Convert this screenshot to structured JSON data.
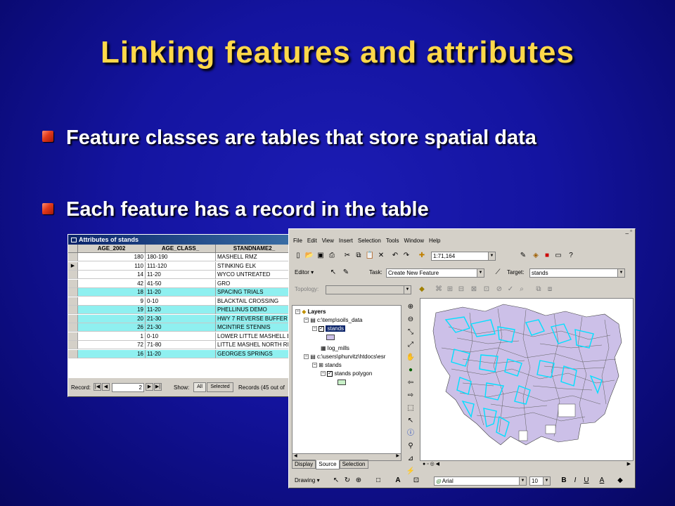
{
  "slide": {
    "title": "Linking features and attributes",
    "bullets": [
      "Feature classes are tables that store spatial data",
      "Each feature has a record in the table"
    ]
  },
  "attr_window": {
    "title": "Attributes of stands",
    "columns": [
      "AGE_2002",
      "AGE_CLASS_",
      "STANDNAME2_"
    ],
    "rows": [
      {
        "age": "180",
        "cls": "180-190",
        "name": "MASHELL RMZ",
        "hl": false
      },
      {
        "age": "110",
        "cls": "111-120",
        "name": "STINKING ELK",
        "hl": false
      },
      {
        "age": "14",
        "cls": "11-20",
        "name": "WYCO UNTREATED",
        "hl": false
      },
      {
        "age": "42",
        "cls": "41-50",
        "name": "GRO",
        "hl": false
      },
      {
        "age": "18",
        "cls": "11-20",
        "name": "SPACING TRIALS",
        "hl": true
      },
      {
        "age": "9",
        "cls": "0-10",
        "name": "BLACKTAIL CROSSING",
        "hl": false
      },
      {
        "age": "19",
        "cls": "11-20",
        "name": "PHELLINUS DEMO",
        "hl": true
      },
      {
        "age": "20",
        "cls": "21-30",
        "name": "HWY 7 REVERSE BUFFER",
        "hl": true
      },
      {
        "age": "26",
        "cls": "21-30",
        "name": "MCINTIRE STENNIS",
        "hl": true
      },
      {
        "age": "1",
        "cls": "0-10",
        "name": "LOWER LITTLE MASHELL E",
        "hl": false
      },
      {
        "age": "72",
        "cls": "71-80",
        "name": "LITTLE MASHEL NORTH RM",
        "hl": false
      },
      {
        "age": "16",
        "cls": "11-20",
        "name": "GEORGES SPRINGS",
        "hl": true
      }
    ],
    "record_label": "Record:",
    "record_value": "2",
    "show_label": "Show:",
    "all_btn": "All",
    "selected_btn": "Selected",
    "records_text": "Records (45 out of"
  },
  "arcmap": {
    "menu": [
      "File",
      "Edit",
      "View",
      "Insert",
      "Selection",
      "Tools",
      "Window",
      "Help"
    ],
    "scale": "1:71,164",
    "editor_label": "Editor",
    "task_label": "Task:",
    "task_value": "Create New Feature",
    "target_label": "Target:",
    "target_value": "stands",
    "topology_label": "Topology:",
    "toc": {
      "layers": "Layers",
      "gdb1": "c:\\temp\\soils_data",
      "stands": "stands",
      "log_mills": "log_mills",
      "gdb2": "c:\\users\\phurvitz\\htdocs\\esr",
      "stands2": "stands",
      "stands_polygon": "stands polygon"
    },
    "tabs": [
      "Display",
      "Source",
      "Selection"
    ],
    "drawing_label": "Drawing",
    "font_name": "Arial",
    "font_size": "10",
    "colors": {
      "polygon_fill": "#ccc0e8",
      "selected_outline": "#00ffff"
    }
  }
}
